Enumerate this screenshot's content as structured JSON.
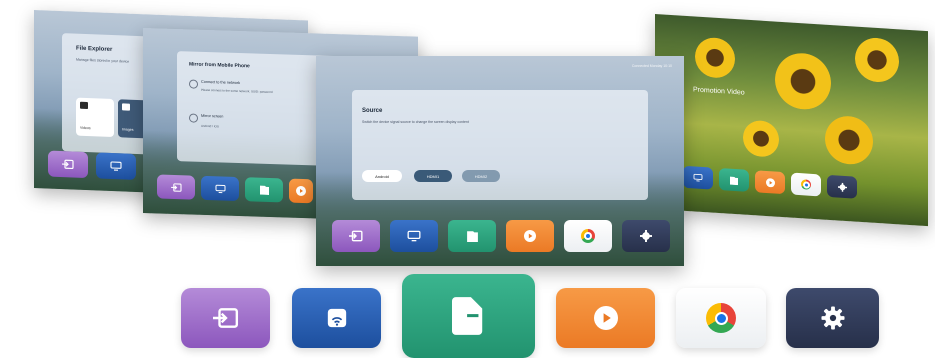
{
  "screens": {
    "file_explorer": {
      "title": "File Explorer",
      "desc": "Manage files stored in your device",
      "items": [
        "Videos",
        "Images"
      ]
    },
    "mirror": {
      "title": "Mirror from Mobile Phone",
      "step1_title": "Connect to the network",
      "step1_desc": "Please connect to the same network. SSID: password",
      "step2_title": "Mirror screen",
      "step2_desc": "Android / iOS"
    },
    "source": {
      "title": "Source",
      "desc": "Switch the device signal source to change the screen display content",
      "status": "Connected   Monday 10:10",
      "options": [
        "Android",
        "HDMI1",
        "HDMI2"
      ]
    },
    "promotion": {
      "title": "Promotion Video"
    }
  },
  "dock": {
    "apps": [
      {
        "name": "source",
        "icon": "input-icon",
        "color": "#8c57bd"
      },
      {
        "name": "screen-mirroring",
        "icon": "cast-icon",
        "color": "#1d4f9e"
      },
      {
        "name": "file-explorer",
        "icon": "folder-icon",
        "color": "#22936f"
      },
      {
        "name": "video-player",
        "icon": "play-icon",
        "color": "#eb7a25"
      },
      {
        "name": "chrome",
        "icon": "chrome-icon",
        "color": "#ffffff"
      },
      {
        "name": "settings",
        "icon": "gear-icon",
        "color": "#27304a"
      }
    ]
  }
}
